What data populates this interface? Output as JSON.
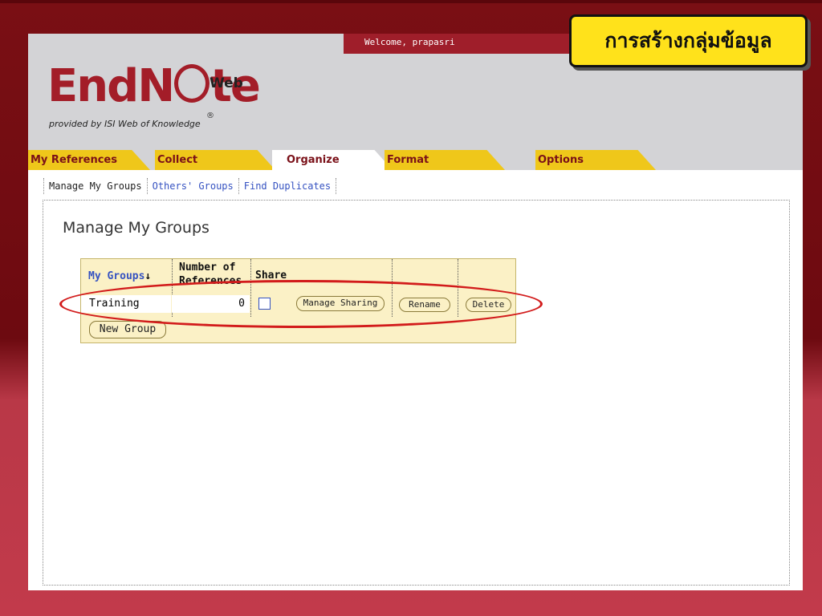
{
  "welcome": "Welcome, prapasri",
  "logo": {
    "text_a": "EndN",
    "text_b": "te",
    "web": "Web",
    "reg": "®",
    "subtitle": "provided by ISI Web of Knowledge"
  },
  "tabs": [
    "My References",
    "Collect",
    "Organize",
    "Format",
    "Options"
  ],
  "subnav": [
    "Manage My Groups",
    "Others' Groups",
    "Find Duplicates"
  ],
  "page_title": "Manage My Groups",
  "table": {
    "col_groups": "My Groups",
    "sort_arrow": "↓",
    "col_count_1": "Number of",
    "col_count_2": "References",
    "col_share": "Share",
    "rows": [
      {
        "name": "Training",
        "count": "0"
      }
    ]
  },
  "buttons": {
    "manage_sharing": "Manage Sharing",
    "rename": "Rename",
    "delete": "Delete",
    "new_group": "New Group"
  },
  "callout": "การสร้างกลุ่มข้อมูล",
  "colors": {
    "accent": "#a31d28",
    "tab_yellow": "#efc71a",
    "highlight_circle": "#d21b1b"
  }
}
